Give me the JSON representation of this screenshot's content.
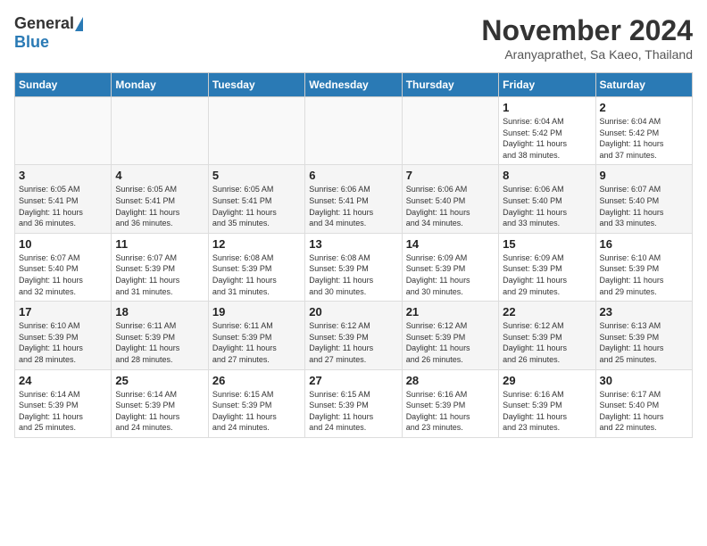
{
  "header": {
    "logo_general": "General",
    "logo_blue": "Blue",
    "month_title": "November 2024",
    "location": "Aranyaprathet, Sa Kaeo, Thailand"
  },
  "weekdays": [
    "Sunday",
    "Monday",
    "Tuesday",
    "Wednesday",
    "Thursday",
    "Friday",
    "Saturday"
  ],
  "weeks": [
    [
      {
        "day": "",
        "info": ""
      },
      {
        "day": "",
        "info": ""
      },
      {
        "day": "",
        "info": ""
      },
      {
        "day": "",
        "info": ""
      },
      {
        "day": "",
        "info": ""
      },
      {
        "day": "1",
        "info": "Sunrise: 6:04 AM\nSunset: 5:42 PM\nDaylight: 11 hours\nand 38 minutes."
      },
      {
        "day": "2",
        "info": "Sunrise: 6:04 AM\nSunset: 5:42 PM\nDaylight: 11 hours\nand 37 minutes."
      }
    ],
    [
      {
        "day": "3",
        "info": "Sunrise: 6:05 AM\nSunset: 5:41 PM\nDaylight: 11 hours\nand 36 minutes."
      },
      {
        "day": "4",
        "info": "Sunrise: 6:05 AM\nSunset: 5:41 PM\nDaylight: 11 hours\nand 36 minutes."
      },
      {
        "day": "5",
        "info": "Sunrise: 6:05 AM\nSunset: 5:41 PM\nDaylight: 11 hours\nand 35 minutes."
      },
      {
        "day": "6",
        "info": "Sunrise: 6:06 AM\nSunset: 5:41 PM\nDaylight: 11 hours\nand 34 minutes."
      },
      {
        "day": "7",
        "info": "Sunrise: 6:06 AM\nSunset: 5:40 PM\nDaylight: 11 hours\nand 34 minutes."
      },
      {
        "day": "8",
        "info": "Sunrise: 6:06 AM\nSunset: 5:40 PM\nDaylight: 11 hours\nand 33 minutes."
      },
      {
        "day": "9",
        "info": "Sunrise: 6:07 AM\nSunset: 5:40 PM\nDaylight: 11 hours\nand 33 minutes."
      }
    ],
    [
      {
        "day": "10",
        "info": "Sunrise: 6:07 AM\nSunset: 5:40 PM\nDaylight: 11 hours\nand 32 minutes."
      },
      {
        "day": "11",
        "info": "Sunrise: 6:07 AM\nSunset: 5:39 PM\nDaylight: 11 hours\nand 31 minutes."
      },
      {
        "day": "12",
        "info": "Sunrise: 6:08 AM\nSunset: 5:39 PM\nDaylight: 11 hours\nand 31 minutes."
      },
      {
        "day": "13",
        "info": "Sunrise: 6:08 AM\nSunset: 5:39 PM\nDaylight: 11 hours\nand 30 minutes."
      },
      {
        "day": "14",
        "info": "Sunrise: 6:09 AM\nSunset: 5:39 PM\nDaylight: 11 hours\nand 30 minutes."
      },
      {
        "day": "15",
        "info": "Sunrise: 6:09 AM\nSunset: 5:39 PM\nDaylight: 11 hours\nand 29 minutes."
      },
      {
        "day": "16",
        "info": "Sunrise: 6:10 AM\nSunset: 5:39 PM\nDaylight: 11 hours\nand 29 minutes."
      }
    ],
    [
      {
        "day": "17",
        "info": "Sunrise: 6:10 AM\nSunset: 5:39 PM\nDaylight: 11 hours\nand 28 minutes."
      },
      {
        "day": "18",
        "info": "Sunrise: 6:11 AM\nSunset: 5:39 PM\nDaylight: 11 hours\nand 28 minutes."
      },
      {
        "day": "19",
        "info": "Sunrise: 6:11 AM\nSunset: 5:39 PM\nDaylight: 11 hours\nand 27 minutes."
      },
      {
        "day": "20",
        "info": "Sunrise: 6:12 AM\nSunset: 5:39 PM\nDaylight: 11 hours\nand 27 minutes."
      },
      {
        "day": "21",
        "info": "Sunrise: 6:12 AM\nSunset: 5:39 PM\nDaylight: 11 hours\nand 26 minutes."
      },
      {
        "day": "22",
        "info": "Sunrise: 6:12 AM\nSunset: 5:39 PM\nDaylight: 11 hours\nand 26 minutes."
      },
      {
        "day": "23",
        "info": "Sunrise: 6:13 AM\nSunset: 5:39 PM\nDaylight: 11 hours\nand 25 minutes."
      }
    ],
    [
      {
        "day": "24",
        "info": "Sunrise: 6:14 AM\nSunset: 5:39 PM\nDaylight: 11 hours\nand 25 minutes."
      },
      {
        "day": "25",
        "info": "Sunrise: 6:14 AM\nSunset: 5:39 PM\nDaylight: 11 hours\nand 24 minutes."
      },
      {
        "day": "26",
        "info": "Sunrise: 6:15 AM\nSunset: 5:39 PM\nDaylight: 11 hours\nand 24 minutes."
      },
      {
        "day": "27",
        "info": "Sunrise: 6:15 AM\nSunset: 5:39 PM\nDaylight: 11 hours\nand 24 minutes."
      },
      {
        "day": "28",
        "info": "Sunrise: 6:16 AM\nSunset: 5:39 PM\nDaylight: 11 hours\nand 23 minutes."
      },
      {
        "day": "29",
        "info": "Sunrise: 6:16 AM\nSunset: 5:39 PM\nDaylight: 11 hours\nand 23 minutes."
      },
      {
        "day": "30",
        "info": "Sunrise: 6:17 AM\nSunset: 5:40 PM\nDaylight: 11 hours\nand 22 minutes."
      }
    ]
  ]
}
